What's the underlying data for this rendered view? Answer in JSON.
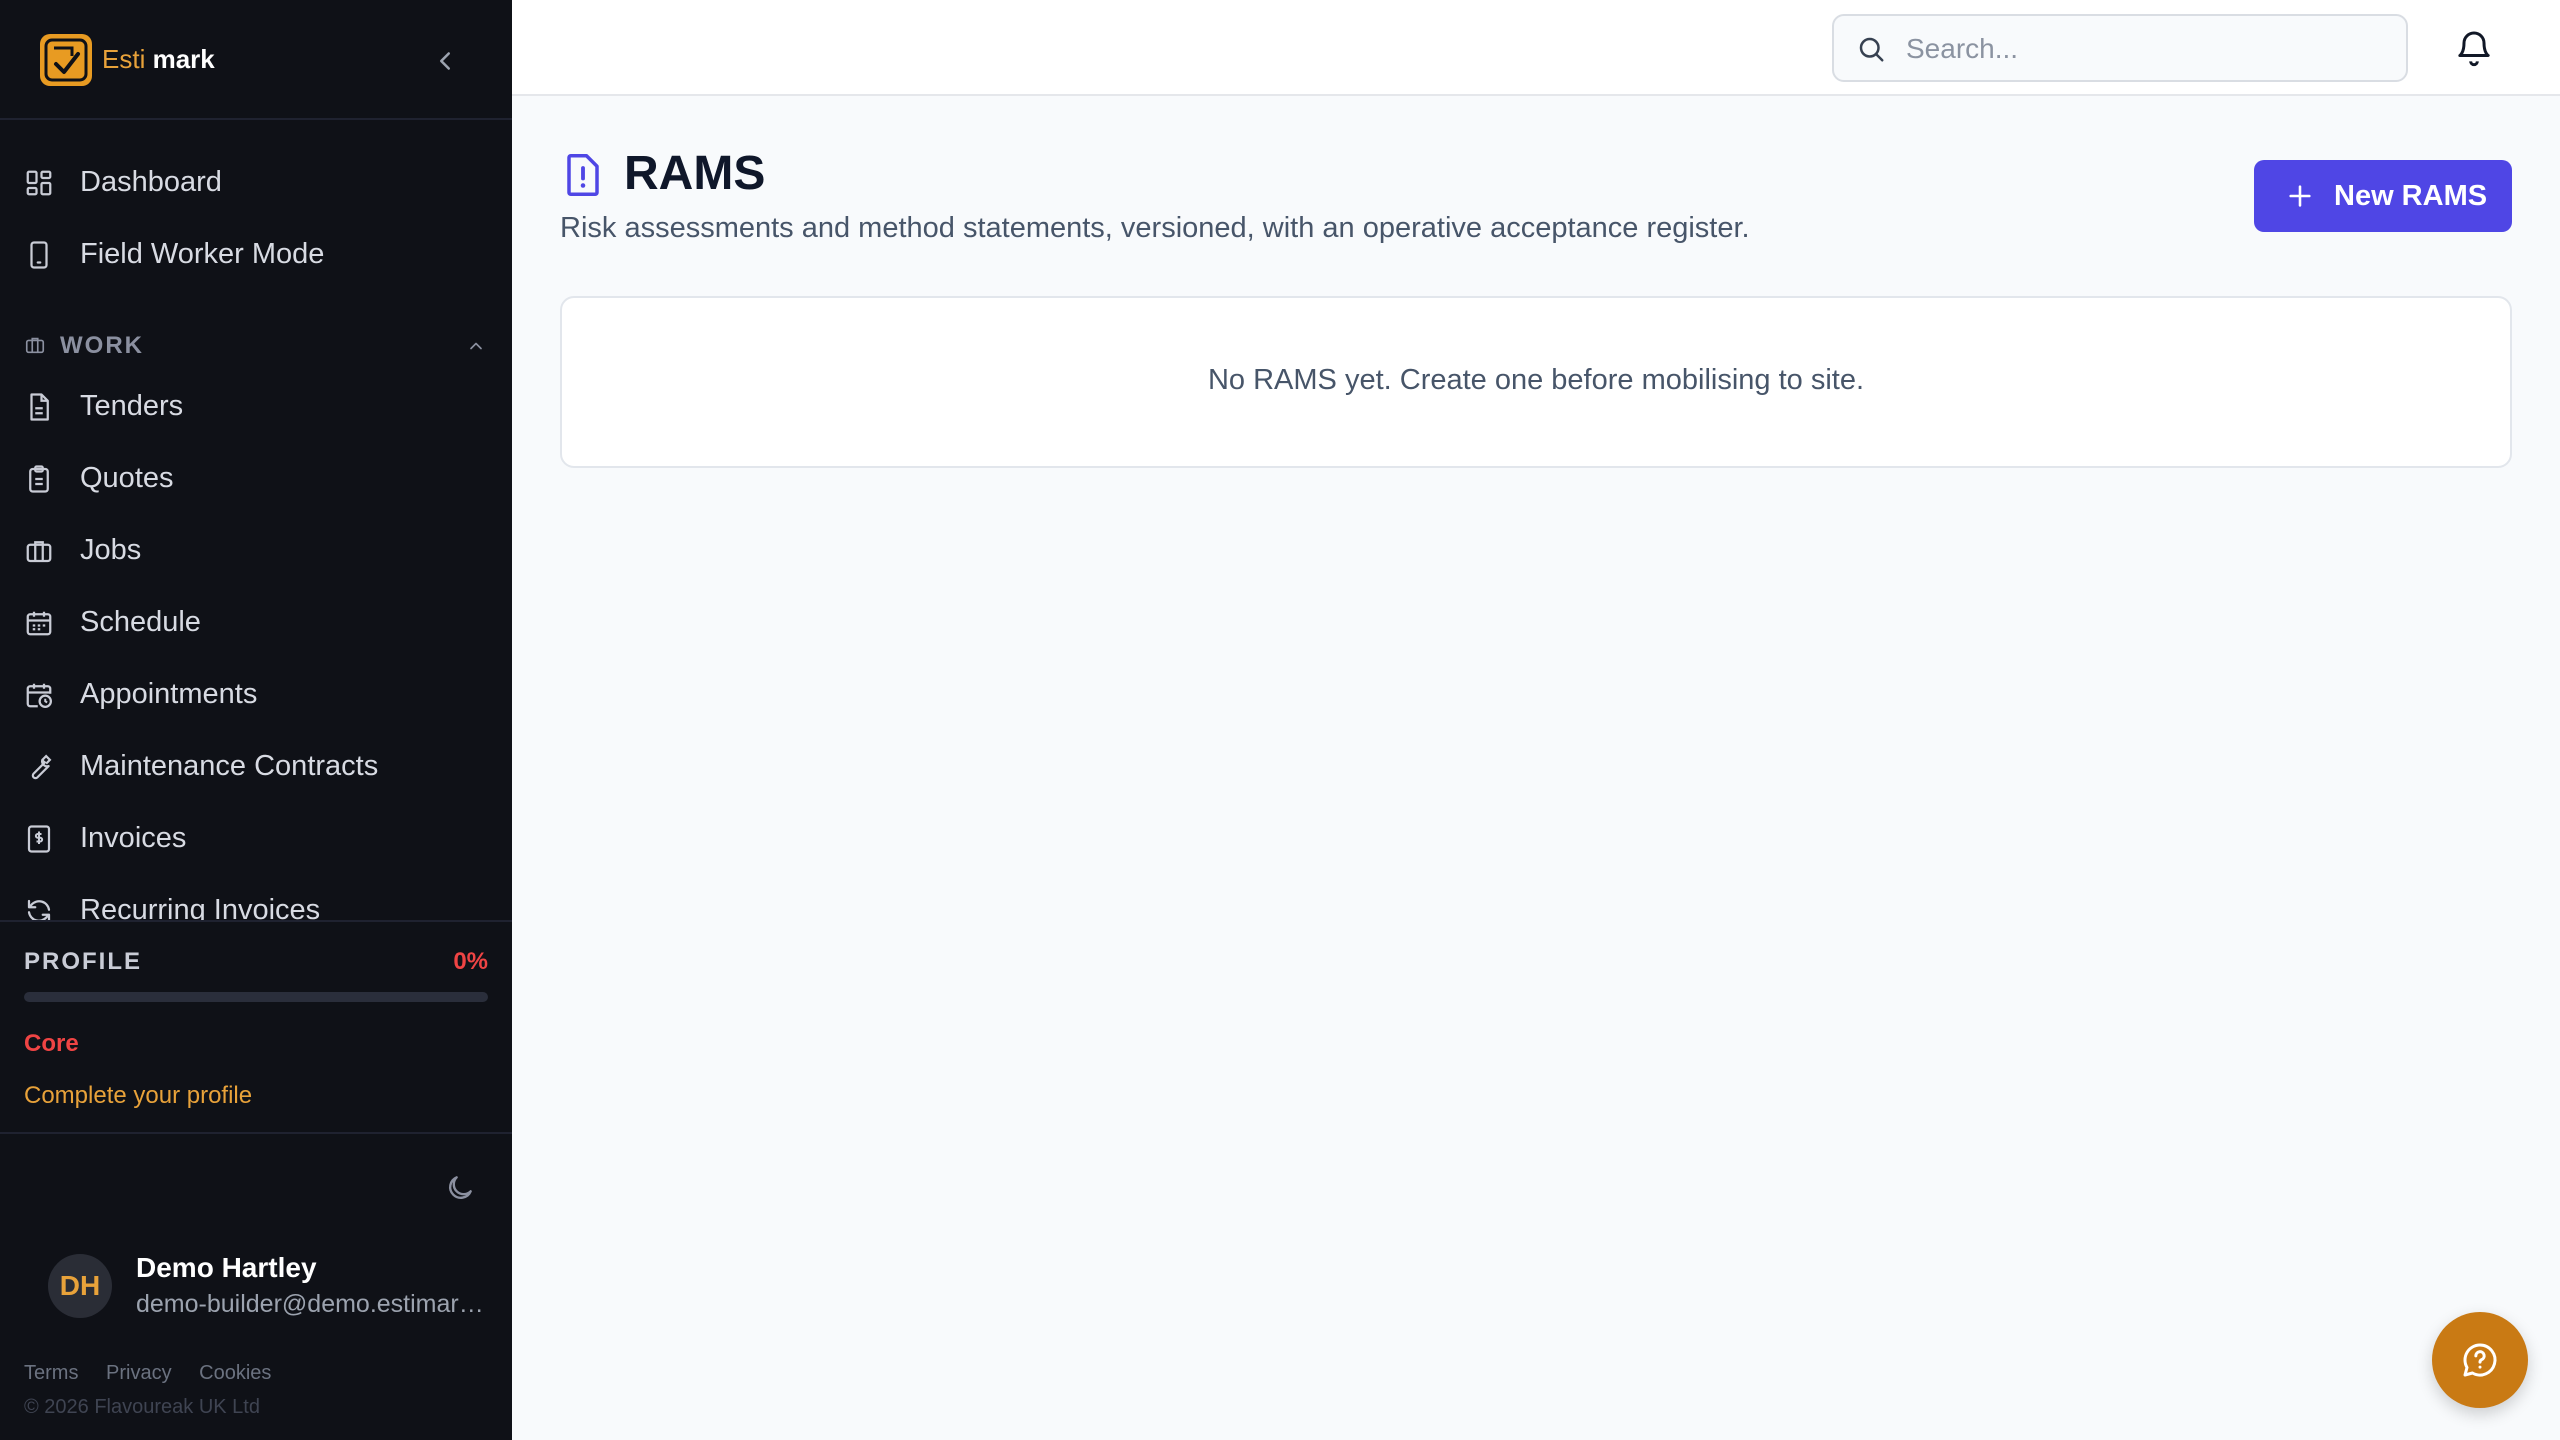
{
  "brand": {
    "name_part1": "Esti",
    "name_part2": "mark"
  },
  "sidebar": {
    "top_items": [
      {
        "label": "Dashboard",
        "icon": "grid-icon"
      },
      {
        "label": "Field Worker Mode",
        "icon": "phone-icon"
      }
    ],
    "section": {
      "label": "WORK",
      "icon": "briefcase-icon",
      "expanded": true
    },
    "work_items": [
      {
        "label": "Tenders",
        "icon": "document-icon"
      },
      {
        "label": "Quotes",
        "icon": "clipboard-icon"
      },
      {
        "label": "Jobs",
        "icon": "briefcase-icon"
      },
      {
        "label": "Schedule",
        "icon": "calendar-icon"
      },
      {
        "label": "Appointments",
        "icon": "calendar-clock-icon"
      },
      {
        "label": "Maintenance Contracts",
        "icon": "wrench-icon"
      },
      {
        "label": "Invoices",
        "icon": "receipt-icon"
      },
      {
        "label": "Recurring Invoices",
        "icon": "refresh-icon"
      }
    ],
    "profile": {
      "title": "PROFILE",
      "percent_label": "0%",
      "progress": 0,
      "level": "Core",
      "cta": "Complete your profile"
    },
    "user": {
      "initials": "DH",
      "name": "Demo Hartley",
      "email": "demo-builder@demo.estimark.co.uk"
    },
    "footer": {
      "terms": "Terms",
      "privacy": "Privacy",
      "cookies": "Cookies",
      "copyright": "© 2026 Flavoureak UK Ltd"
    }
  },
  "topbar": {
    "search_placeholder": "Search..."
  },
  "main": {
    "title": "RAMS",
    "subtitle": "Risk assessments and method statements, versioned, with an operative acceptance register.",
    "new_button": "New RAMS",
    "empty_message": "No RAMS yet. Create one before mobilising to site."
  },
  "colors": {
    "sidebar_bg": "#0f1117",
    "accent": "#4f46e5",
    "brand": "#e89b22",
    "danger": "#ef4444"
  }
}
